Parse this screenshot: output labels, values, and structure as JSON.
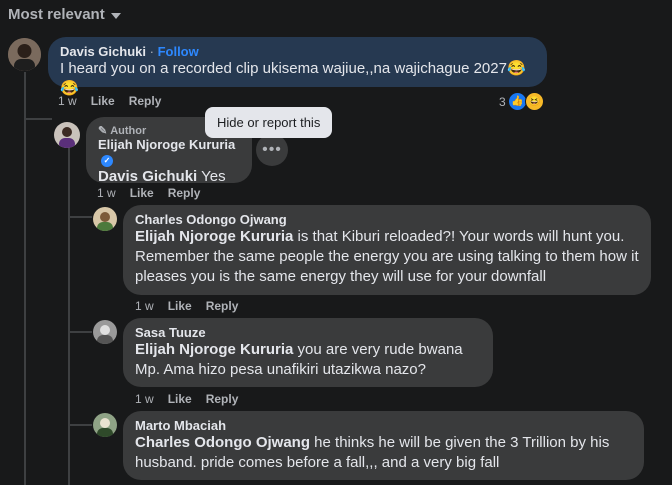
{
  "sort": {
    "label": "Most relevant"
  },
  "tooltip": {
    "text": "Hide or report this"
  },
  "comments": [
    {
      "author": "Davis Gichuki",
      "follow": "Follow",
      "separator": "·",
      "text": "I heard you on a recorded clip ukisema wajiue,,na wajichague 2027😂😂",
      "time": "1 w",
      "like": "Like",
      "reply": "Reply",
      "reaction_count": "3",
      "reactions": [
        "like",
        "haha"
      ]
    },
    {
      "author_tag": "Author",
      "author": "Elijah Njoroge Kururia",
      "mention": "Davis Gichuki",
      "text": " Yes",
      "time": "1 w",
      "like": "Like",
      "reply": "Reply"
    },
    {
      "author": "Charles Odongo Ojwang",
      "mention": "Elijah Njoroge Kururia",
      "text": " is that Kiburi reloaded?! Your words will hunt you. Remember the same people the energy you are using talking to them how it pleases you is the same energy they will use for your downfall",
      "time": "1 w",
      "like": "Like",
      "reply": "Reply"
    },
    {
      "author": "Sasa Tuuze",
      "mention": "Elijah Njoroge Kururia",
      "text": " you are very rude bwana Mp. Ama hizo pesa unafikiri utazikwa nazo?",
      "time": "1 w",
      "like": "Like",
      "reply": "Reply"
    },
    {
      "author": "Marto Mbaciah",
      "mention": "Charles Odongo Ojwang",
      "text": " he thinks he will be given the 3 Trillion by his husband. pride comes before a fall,,, and a very big fall"
    }
  ],
  "colors": {
    "background": "#18191a",
    "bubble": "#3a3b3c",
    "bubble_highlight": "#263951",
    "link": "#2d88ff"
  }
}
